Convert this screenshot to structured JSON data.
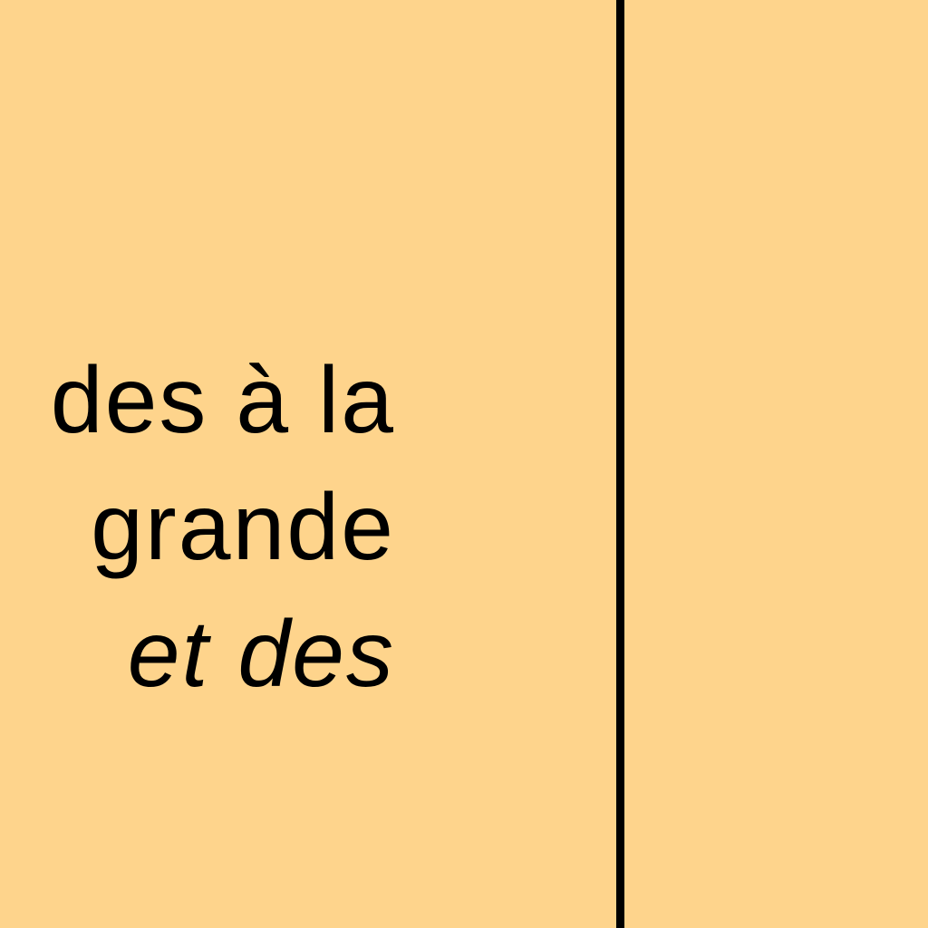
{
  "colors": {
    "background": "#FED48C",
    "divider": "#000000",
    "text": "#000000"
  },
  "content": {
    "lines": [
      "des à la",
      "grande",
      "et des"
    ]
  }
}
